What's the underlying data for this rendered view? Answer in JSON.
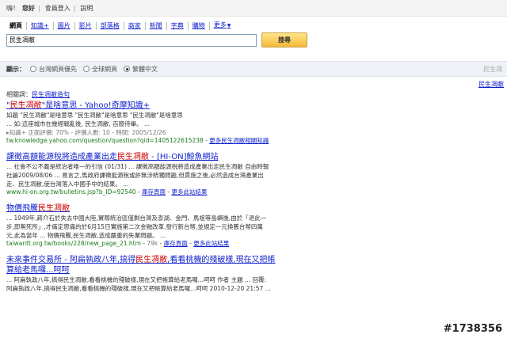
{
  "topbar": {
    "greeting": "嗨！",
    "name": "您好",
    "login": "會員登入",
    "help": "說明"
  },
  "tabs": [
    {
      "label": "網頁",
      "active": true
    },
    {
      "label": "知識+"
    },
    {
      "label": "圖片"
    },
    {
      "label": "影片"
    },
    {
      "label": "部落格"
    },
    {
      "label": "商家"
    },
    {
      "label": "新聞"
    },
    {
      "label": "字典"
    },
    {
      "label": "購物"
    },
    {
      "label": "更多"
    }
  ],
  "search": {
    "value": "民生凋敝",
    "button": "搜尋"
  },
  "options": {
    "label": "顯示：",
    "opt1": "台灣網頁優先",
    "opt2": "全球網頁",
    "opt3": "繁體中文",
    "selected": 3,
    "right": "民生凋"
  },
  "side_heading": "民生凋敝",
  "related": {
    "label": "相關詞：",
    "link": "民生凋敝造句"
  },
  "results": [
    {
      "title_pre": "\"",
      "title_hl": "民生凋敝",
      "title_post": "\"是啥意思 - Yahoo!奇摩知識+",
      "snippet_1": "如題 \"民生凋敝\"是啥意思 \"民生凋敝\"是啥意思 \"民生凋敝\"是啥意思",
      "snippet_2": "... 如:這座城市在幾經戰亂後, 民生凋敝, 百廢待舉。 ...",
      "meta_line": "知識+   正面評價: 70% - 評價人數: 10 - 時間: 2005/12/26",
      "url": "tw.knowledge.yahoo.com/question/question?qid=1405122615238",
      "more": "更多民生凋敝相關知識"
    },
    {
      "title_pre": "課徵高額能源稅將造成產業出走",
      "title_hl": "民生凋敝",
      "title_post": " - [HI-ON]鯨魚網站",
      "snippet_1": "... 社會不公不義是統治者唯一的引信 (01/31) ... 課徵高額能源稅將造成產業出走民生凋敝 自由時報",
      "snippet_2": "社論2009/08/06 ... 易言之,馬政府課徵能源稅或許無涉統獨問題,但貫施之後,必然造成台灣產業出",
      "snippet_3": "走、民生凋敝,使台灣落入中國手中的結果。 ...",
      "url": "www.hi-on.org.tw/bulletins.jsp?b_ID=92540",
      "cache": "庫存頁面",
      "more_site": "更多此站結果"
    },
    {
      "title_pre": "物價飛騰",
      "title_hl": "民生凋敝",
      "title_post": "",
      "snippet_1": "... 1949年,蔣介石於失去中國大陸,實際統治區僅剩台灣及澎湖、金門、馬祖等島嶼後,由於「退此一",
      "snippet_2": "步,即無死所」,才痛定思痛的於6月15日實施第二次金融改革,發行新台幣,並規定一元換舊台幣四萬",
      "snippet_3": "元,此為當年 ... 物價飛騰,民生凋敝,造成嚴重的失業問題。 ...",
      "url": "taiwantt.org.tw/books/228/new_page_21.htm",
      "size": "79k",
      "cache": "庫存頁面",
      "more_site": "更多此站結果"
    },
    {
      "title_pre": "未來事件交易所 - 阿扁執政八年,搞得",
      "title_hl": "民生凋敝",
      "title_post": ",看看桃機的殘破樣,現在又把帳算給老馬囉...呵呵",
      "snippet_1": "... 阿扁執政八年,搞得民生凋敝,看看桃機的殘破樣,現在又把帳算給老馬囉...呵呵 作者 主題 ... 回覆:",
      "snippet_2": "阿扁執政八年,搞得民生凋敝,看看桃機的殘破樣,現在又把帳算給老馬囉...呵呵 2010-12-20 21:57 ..."
    }
  ],
  "watermark": "#1738356"
}
